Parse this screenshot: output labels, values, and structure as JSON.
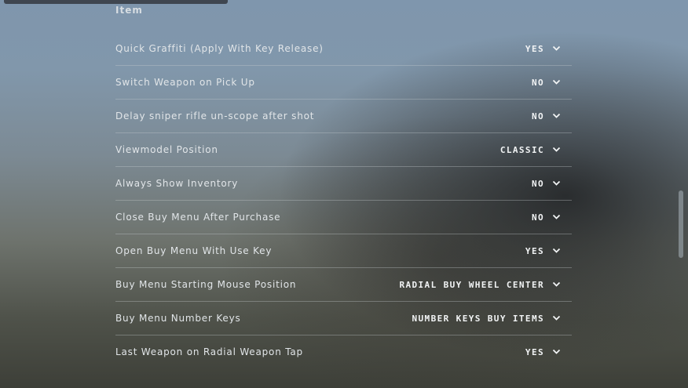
{
  "section": {
    "title": "Item"
  },
  "settings": [
    {
      "label": "Quick Graffiti (Apply With Key Release)",
      "value": "YES"
    },
    {
      "label": "Switch Weapon on Pick Up",
      "value": "NO"
    },
    {
      "label": "Delay sniper rifle un-scope after shot",
      "value": "NO"
    },
    {
      "label": "Viewmodel Position",
      "value": "CLASSIC"
    },
    {
      "label": "Always Show Inventory",
      "value": "NO"
    },
    {
      "label": "Close Buy Menu After Purchase",
      "value": "NO"
    },
    {
      "label": "Open Buy Menu With Use Key",
      "value": "YES"
    },
    {
      "label": "Buy Menu Starting Mouse Position",
      "value": "RADIAL BUY WHEEL CENTER"
    },
    {
      "label": "Buy Menu Number Keys",
      "value": "NUMBER KEYS BUY ITEMS"
    },
    {
      "label": "Last Weapon on Radial Weapon Tap",
      "value": "YES"
    }
  ],
  "icons": {
    "dropdown": "chevron-down-icon"
  },
  "colors": {
    "text": "#e1e5e8",
    "value": "#f2f4f5",
    "divider": "#c8cdd2"
  }
}
